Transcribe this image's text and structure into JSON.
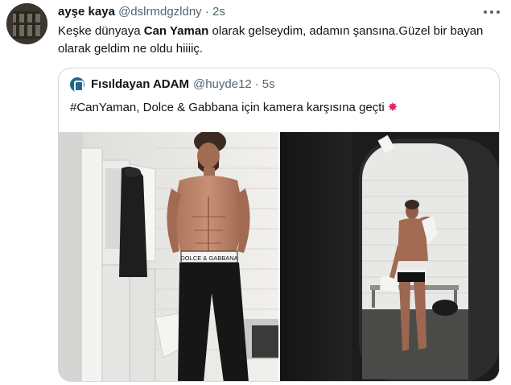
{
  "tweet": {
    "author_name": "ayşe kaya",
    "author_handle": "@dslrmdgzldny",
    "separator": "·",
    "time": "2s",
    "text_before": "Keşke dünyaya ",
    "text_bold": "Can Yaman",
    "text_after": " olarak gelseydim, adamın şansına.Güzel bir bayan olarak geldim ne oldu hiiiiç."
  },
  "quote": {
    "author_name": "Fısıldayan ADAM",
    "author_handle": "@huyde12",
    "separator": "·",
    "time": "5s",
    "text": "#CanYaman, Dolce & Gabbana için kamera karşısına geçti",
    "emoji": "collision-emoji",
    "underwear_brand": "DOLCE & GABBANA"
  },
  "icons": {
    "more": "more-horizontal-icon",
    "quote_avatar": "fisildayan-adam-logo"
  },
  "colors": {
    "text_primary": "#0f1419",
    "text_secondary": "#536471",
    "border": "#cfd9de"
  }
}
